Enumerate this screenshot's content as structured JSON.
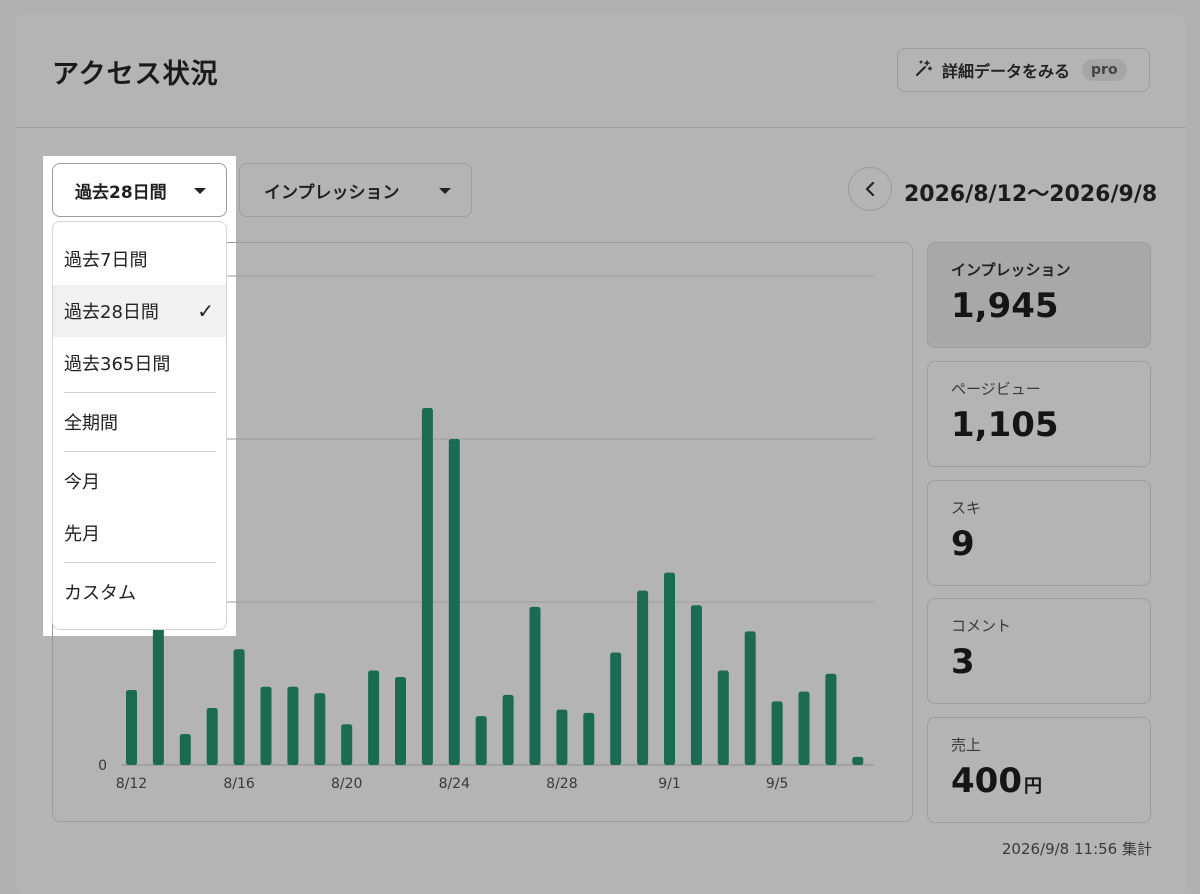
{
  "header": {
    "title": "アクセス状況",
    "detail_button_label": "詳細データをみる",
    "pro_badge": "pro"
  },
  "filters": {
    "period_selected": "過去28日間",
    "metric_selected": "インプレッション",
    "date_range": "2026/8/12〜2026/9/8"
  },
  "period_menu": {
    "items": [
      "過去7日間",
      "過去28日間",
      "過去365日間",
      "全期間",
      "今月",
      "先月",
      "カスタム"
    ],
    "selected": "過去28日間"
  },
  "stats": [
    {
      "label": "インプレッション",
      "value": "1,945",
      "active": true
    },
    {
      "label": "ページビュー",
      "value": "1,105"
    },
    {
      "label": "スキ",
      "value": "9"
    },
    {
      "label": "コメント",
      "value": "3"
    },
    {
      "label": "売上",
      "value": "400",
      "unit": "円"
    }
  ],
  "aggregated_at": "2026/9/8 11:56 集計",
  "colors": {
    "bar": "#1a6b52",
    "accent_bg": "#a8a8a8"
  },
  "chart_data": {
    "type": "bar",
    "x": [
      "8/12",
      "8/13",
      "8/14",
      "8/15",
      "8/16",
      "8/17",
      "8/18",
      "8/19",
      "8/20",
      "8/21",
      "8/22",
      "8/23",
      "8/24",
      "8/25",
      "8/26",
      "8/27",
      "8/28",
      "8/29",
      "8/30",
      "8/31",
      "9/1",
      "9/2",
      "9/3",
      "9/4",
      "9/5",
      "9/6",
      "9/7",
      "9/8"
    ],
    "values": [
      46,
      87,
      19,
      35,
      71,
      48,
      48,
      44,
      25,
      58,
      54,
      219,
      200,
      30,
      43,
      97,
      34,
      32,
      69,
      107,
      118,
      98,
      58,
      82,
      39,
      45,
      56,
      5
    ],
    "tick_labels": [
      "8/12",
      "8/16",
      "8/20",
      "8/24",
      "8/28",
      "9/1",
      "9/5"
    ],
    "y_tick_label": "0",
    "ylim": [
      0,
      300
    ],
    "y_gridlines": [
      0,
      100,
      200,
      300
    ],
    "grid": true
  }
}
